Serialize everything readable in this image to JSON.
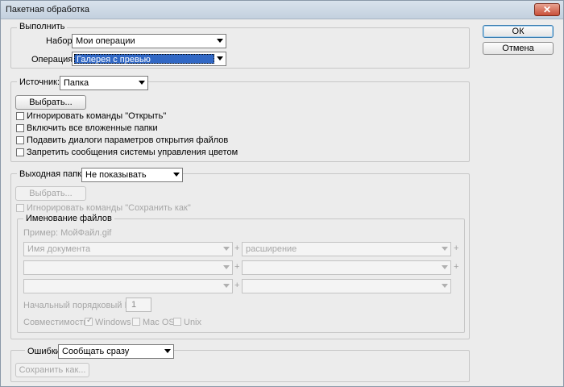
{
  "window": {
    "title": "Пакетная обработка",
    "close_symbol": "✕"
  },
  "buttons": {
    "ok": "ОК",
    "cancel": "Отмена"
  },
  "play": {
    "legend": "Выполнить",
    "set_label": "Набор:",
    "set_value": "Мои операции",
    "action_label": "Операция:",
    "action_value": "Галерея с превью"
  },
  "source": {
    "label": "Источник:",
    "value": "Папка",
    "choose_button": "Выбрать...",
    "options": [
      "Игнорировать команды \"Открыть\"",
      "Включить все вложенные папки",
      "Подавить диалоги параметров открытия файлов",
      "Запретить сообщения системы управления цветом"
    ]
  },
  "destination": {
    "label": "Выходная папка:",
    "value": "Не показывать",
    "choose_button": "Выбрать...",
    "override_save": "Игнорировать команды \"Сохранить как\"",
    "naming": {
      "legend": "Именование файлов",
      "example": "Пример: МойФайл.gif",
      "fields": [
        [
          "Имя документа",
          "расширение"
        ],
        [
          "",
          ""
        ],
        [
          "",
          ""
        ]
      ],
      "plus_symbol": "+",
      "serial_label": "Начальный порядковый №:",
      "serial_value": "1",
      "compat_label": "Совместимость:",
      "compat": [
        {
          "label": "Windows",
          "checked": true
        },
        {
          "label": "Mac OS",
          "checked": false
        },
        {
          "label": "Unix",
          "checked": false
        }
      ],
      "check_symbol": "✓"
    }
  },
  "errors": {
    "label": "Ошибки:",
    "value": "Сообщать сразу",
    "save_button": "Сохранить как..."
  }
}
